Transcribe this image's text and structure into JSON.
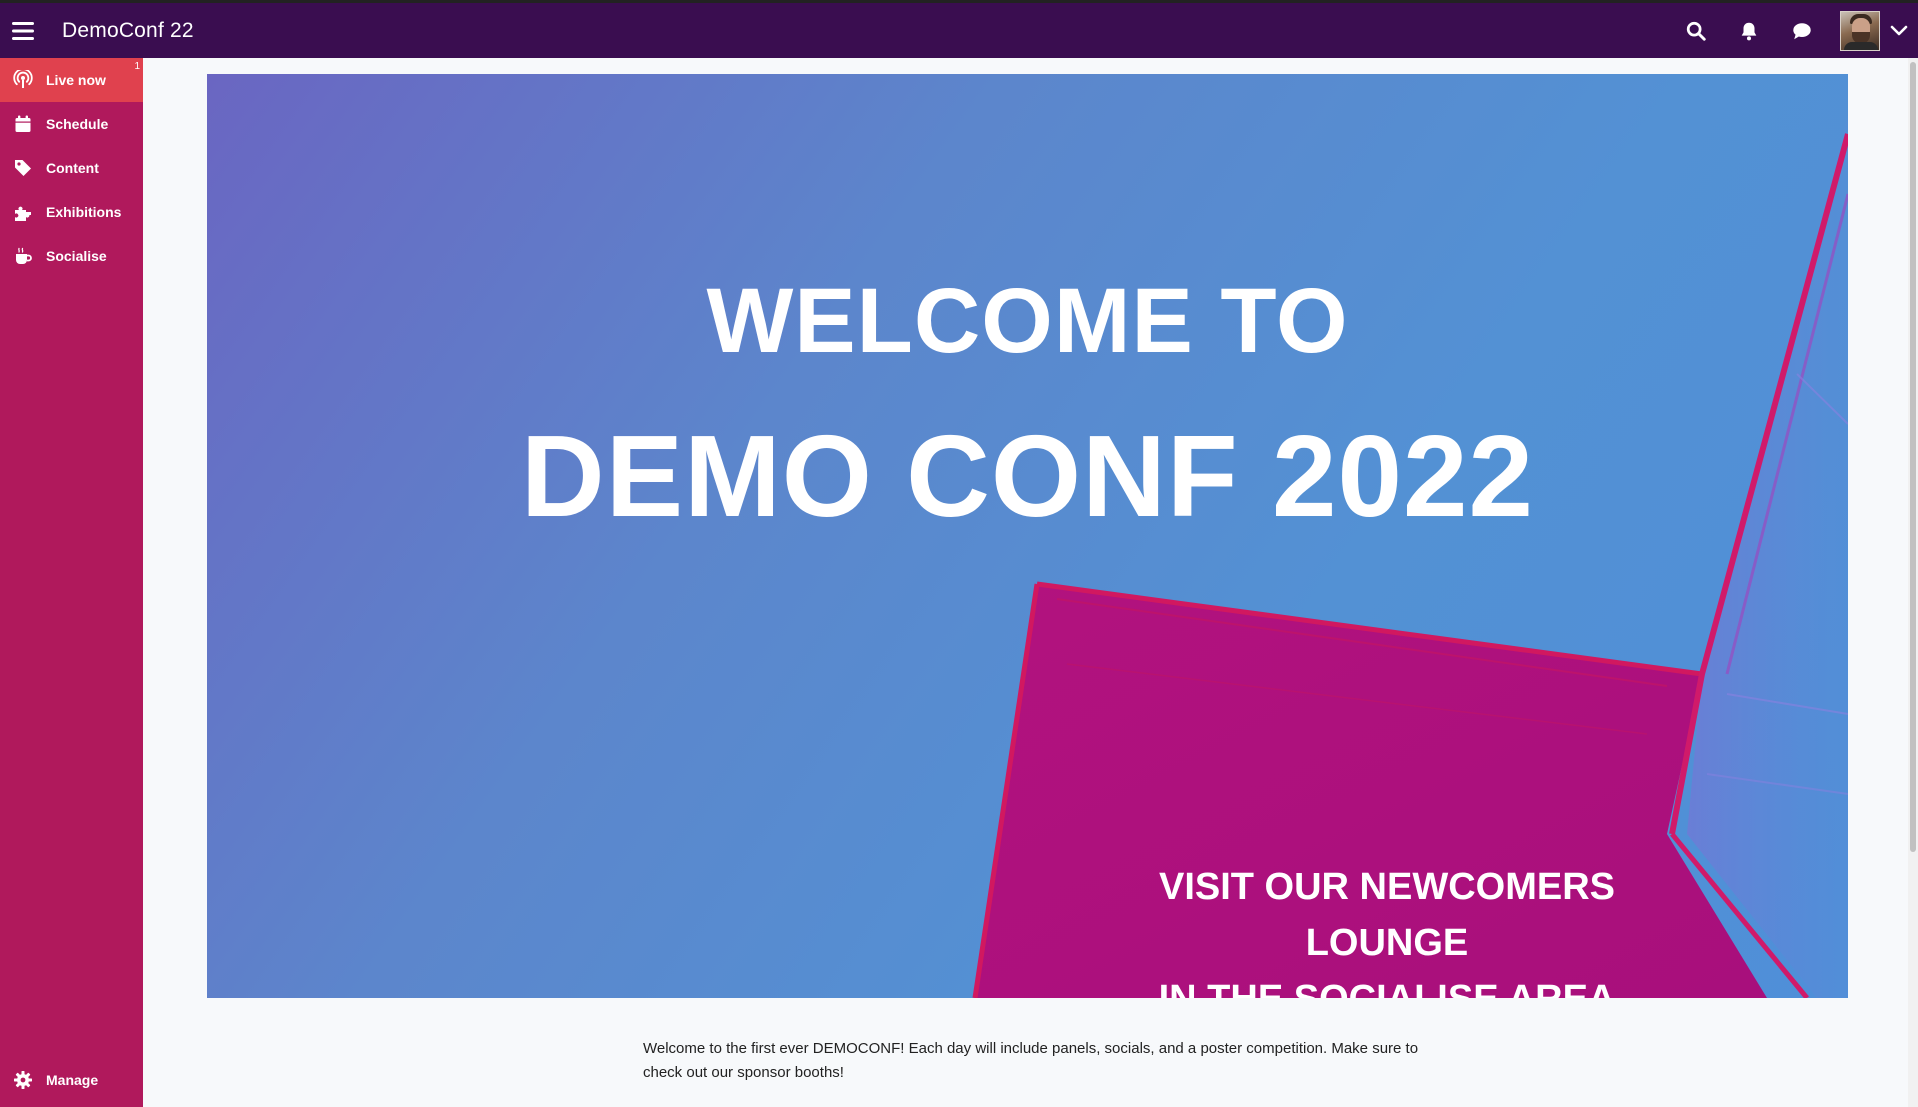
{
  "app": {
    "title": "DemoConf 22"
  },
  "topbar": {
    "icons": [
      "menu-icon",
      "search-icon",
      "bell-icon",
      "chat-icon",
      "chevron-down-icon"
    ],
    "bg_color": "#3a0d50"
  },
  "sidebar": {
    "bg_color": "#b0195c",
    "active_color": "#e0414e",
    "items": [
      {
        "label": "Live now",
        "icon": "broadcast-icon",
        "badge": "1",
        "active": true
      },
      {
        "label": "Schedule",
        "icon": "calendar-icon"
      },
      {
        "label": "Content",
        "icon": "tag-icon"
      },
      {
        "label": "Exhibitions",
        "icon": "puzzle-icon"
      },
      {
        "label": "Socialise",
        "icon": "coffee-icon"
      }
    ],
    "bottom_item": {
      "label": "Manage",
      "icon": "gear-icon"
    }
  },
  "hero": {
    "line1": "WELCOME TO",
    "line2": "DEMO CONF 2022",
    "cta_line1": "VISIT OUR NEWCOMERS LOUNGE",
    "cta_line2": "IN THE SOCIALISE AREA"
  },
  "intro": {
    "text": "Welcome to the first ever DEMOCONF! Each day will include panels, socials, and a poster competition. Make sure to check out our sponsor booths!"
  }
}
